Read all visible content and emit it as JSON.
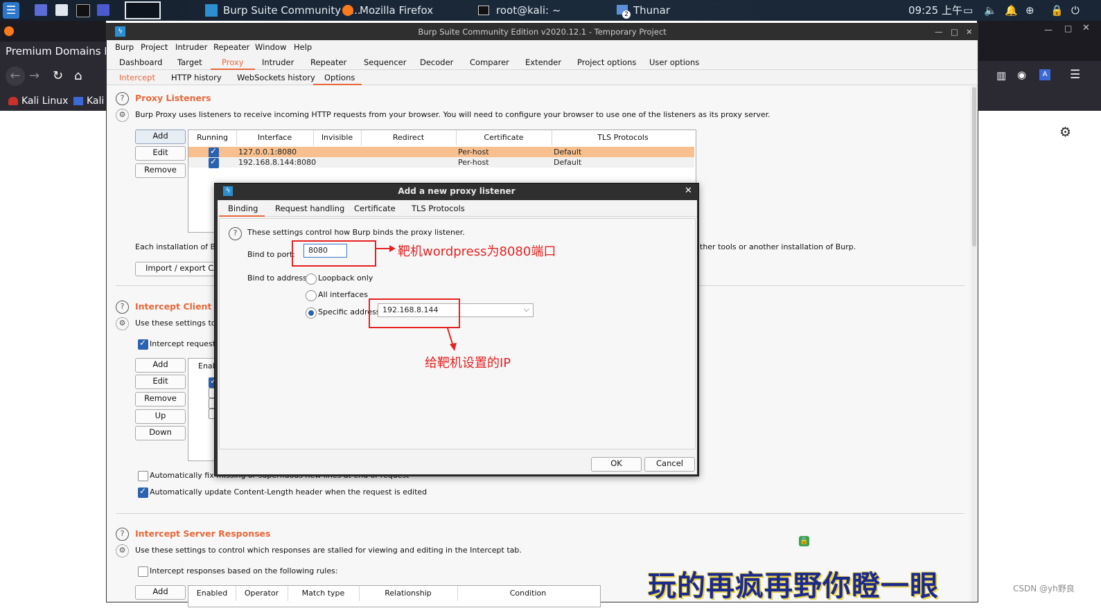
{
  "taskbar": {
    "apps": [
      {
        "label": "Burp Suite Community E..."
      },
      {
        "label": "Mozilla Firefox"
      },
      {
        "label": "root@kali: ~"
      },
      {
        "label": "Thunar"
      }
    ],
    "clock": "09:25 上午",
    "badge": "2"
  },
  "firefox": {
    "tab_text": "Premium Domains For",
    "bookmarks": [
      "Kali Linux",
      "Kali"
    ]
  },
  "burp": {
    "title": "Burp Suite Community Edition v2020.12.1 - Temporary Project",
    "menu": [
      "Burp",
      "Project",
      "Intruder",
      "Repeater",
      "Window",
      "Help"
    ],
    "tabs": [
      "Dashboard",
      "Target",
      "Proxy",
      "Intruder",
      "Repeater",
      "Sequencer",
      "Decoder",
      "Comparer",
      "Extender",
      "Project options",
      "User options"
    ],
    "subtabs": [
      "Intercept",
      "HTTP history",
      "WebSockets history",
      "Options"
    ],
    "proxy_listeners": {
      "title": "Proxy Listeners",
      "desc": "Burp Proxy uses listeners to receive incoming HTTP requests from your browser. You will need to configure your browser to use one of the listeners as its proxy server.",
      "buttons": [
        "Add",
        "Edit",
        "Remove"
      ],
      "columns": [
        "Running",
        "Interface",
        "Invisible",
        "Redirect",
        "Certificate",
        "TLS Protocols"
      ],
      "rows": [
        {
          "running": true,
          "interface": "127.0.0.1:8080",
          "invisible": "",
          "redirect": "",
          "certificate": "Per-host",
          "tls": "Default"
        },
        {
          "running": true,
          "interface": "192.168.8.144:8080",
          "invisible": "",
          "redirect": "",
          "certificate": "Per-host",
          "tls": "Default"
        }
      ],
      "ca_text_left": "Each installation of Burp",
      "ca_text_right": "ther tools or another installation of Burp.",
      "import_button": "Import / export CA ce"
    },
    "intercept_requests": {
      "title": "Intercept Client Req",
      "desc": "Use these settings to co",
      "checkbox_label": "Intercept requests b",
      "buttons": [
        "Add",
        "Edit",
        "Remove",
        "Up",
        "Down"
      ],
      "column": "Enab",
      "auto_fix": "Automatically fix missing or superfluous new lines at end of request",
      "auto_update": "Automatically update Content-Length header when the request is edited"
    },
    "intercept_responses": {
      "title": "Intercept Server Responses",
      "desc": "Use these settings to control which responses are stalled for viewing and editing in the Intercept tab.",
      "checkbox_label": "Intercept responses based on the following rules:",
      "add_button": "Add",
      "columns": [
        "Enabled",
        "Operator",
        "Match type",
        "Relationship",
        "Condition"
      ]
    }
  },
  "dialog": {
    "title": "Add a new proxy listener",
    "tabs": [
      "Binding",
      "Request handling",
      "Certificate",
      "TLS Protocols"
    ],
    "intro": "These settings control how Burp binds the proxy listener.",
    "bind_port_label": "Bind to port:",
    "bind_port_value": "8080",
    "bind_address_label": "Bind to address:",
    "options": [
      "Loopback only",
      "All interfaces",
      "Specific address:"
    ],
    "specific_address": "192.168.8.144",
    "ok": "OK",
    "cancel": "Cancel"
  },
  "annotations": {
    "port_note": "靶机wordpress为8080端口",
    "ip_note": "给靶机设置的IP"
  },
  "watermark": "玩的再疯再野你瞪一眼",
  "credit": "CSDN @yh野良",
  "colors": {
    "accent": "#e8683b",
    "annotation": "#e52121",
    "check": "#2b62b0"
  }
}
